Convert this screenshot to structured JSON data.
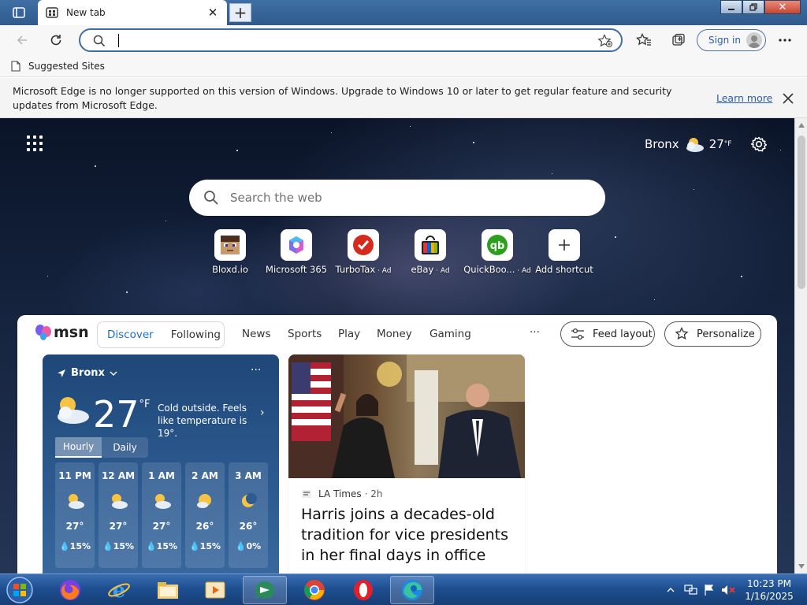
{
  "window": {
    "tab_title": "New tab",
    "new_tab_symbol": "+"
  },
  "address_bar": {
    "value": "",
    "placeholder": ""
  },
  "nav": {
    "signin_label": "Sign in"
  },
  "bookmarks": {
    "label": "Suggested Sites"
  },
  "infobar": {
    "message": "Microsoft Edge is no longer supported on this version of Windows. Upgrade to Windows 10 or later to get regular feature and security updates from Microsoft Edge.",
    "learn_more": "Learn more"
  },
  "top_weather": {
    "city": "Bronx",
    "temp": "27",
    "unit": "°F"
  },
  "search": {
    "placeholder": "Search the web"
  },
  "shortcuts": [
    {
      "label": "Bloxd.io",
      "ad": ""
    },
    {
      "label": "Microsoft 365",
      "ad": ""
    },
    {
      "label": "TurboTax",
      "ad": " · Ad"
    },
    {
      "label": "eBay",
      "ad": " · Ad"
    },
    {
      "label": "QuickBoo...",
      "ad": " · Ad"
    },
    {
      "label": "Add shortcut",
      "ad": ""
    }
  ],
  "feed": {
    "logo": "msn",
    "tabs": {
      "discover": "Discover",
      "following": "Following"
    },
    "nav": [
      "News",
      "Sports",
      "Play",
      "Money",
      "Gaming"
    ],
    "more": "···",
    "feed_layout": "Feed layout",
    "personalize": "Personalize"
  },
  "weather_card": {
    "location": "Bronx",
    "more": "···",
    "temp": "27",
    "unit": "°F",
    "desc": "Cold outside. Feels like temperature is 19°.",
    "tabs": [
      "Hourly",
      "Daily"
    ],
    "hours": [
      {
        "time": "11 PM",
        "temp": "27°",
        "precip": "15%",
        "icon": "cloud-moon-icon"
      },
      {
        "time": "12 AM",
        "temp": "27°",
        "precip": "15%",
        "icon": "cloud-moon-icon"
      },
      {
        "time": "1 AM",
        "temp": "27°",
        "precip": "15%",
        "icon": "cloud-moon-icon"
      },
      {
        "time": "2 AM",
        "temp": "26°",
        "precip": "15%",
        "icon": "partly-cloudy-moon-icon"
      },
      {
        "time": "3 AM",
        "temp": "26°",
        "precip": "0%",
        "icon": "moon-icon"
      }
    ]
  },
  "news": {
    "source": "LA Times",
    "time": "· 2h",
    "headline": "Harris joins a decades-old tradition for vice presidents in her final days in office"
  },
  "clock": {
    "time": "10:23 PM",
    "date": "1/16/2025"
  },
  "colors": {
    "accent": "#1a6fc9",
    "taskbar": "#1e4f91",
    "titlebar": "#3f6fa5"
  }
}
